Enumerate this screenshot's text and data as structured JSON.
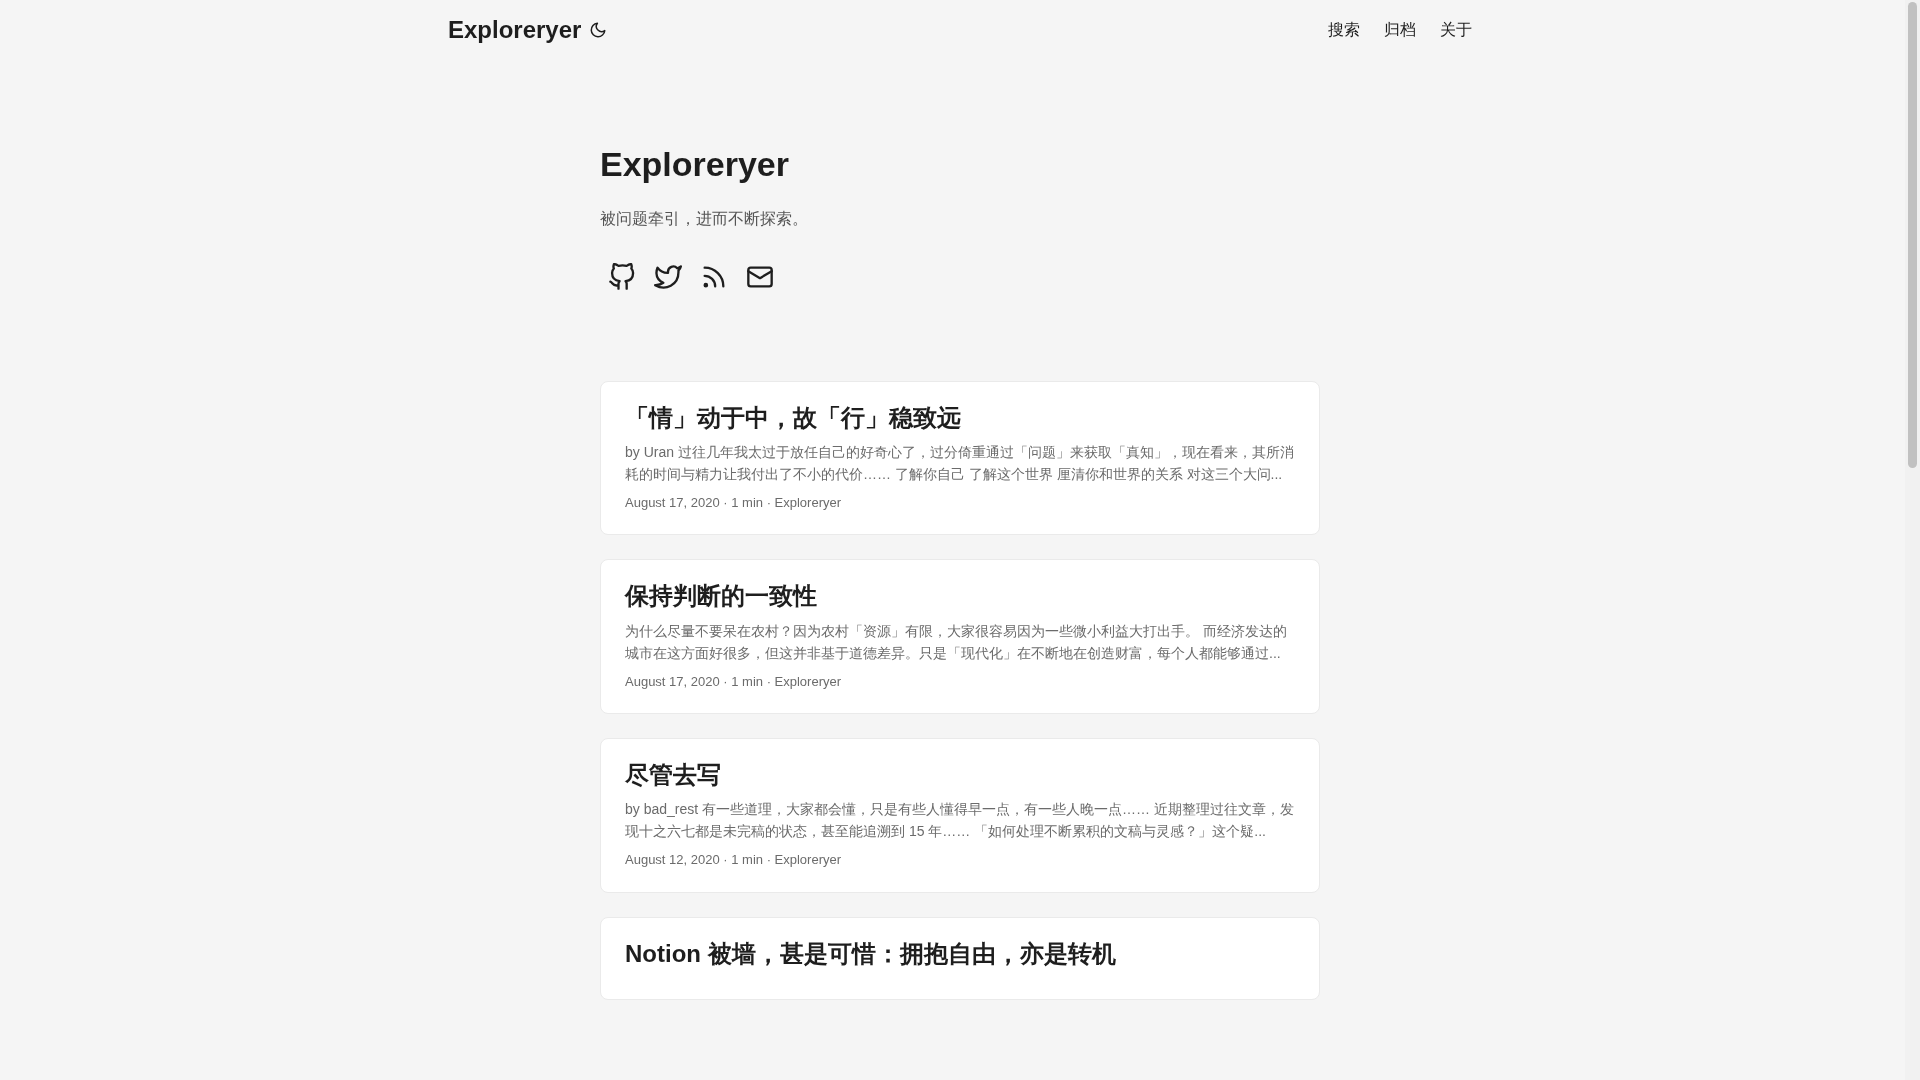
{
  "header": {
    "logo": "Exploreryer",
    "menu": [
      {
        "label": "搜索"
      },
      {
        "label": "归档"
      },
      {
        "label": "关于"
      }
    ]
  },
  "hero": {
    "title": "Exploreryer",
    "subtitle": "被问题牵引，进而不断探索。",
    "social": [
      {
        "kind": "github"
      },
      {
        "kind": "twitter"
      },
      {
        "kind": "rss"
      },
      {
        "kind": "email"
      }
    ]
  },
  "posts": [
    {
      "title": "「情」动于中，故「行」稳致远",
      "excerpt": "by Uran 过往几年我太过于放任自己的好奇心了，过分倚重通过「问题」来获取「真知」，现在看来，其所消耗的时间与精力让我付出了不小的代价…… 了解你自己 了解这个世界 厘清你和世界的关系 对这三个大问...",
      "meta": "August 17, 2020 · 1 min · Exploreryer"
    },
    {
      "title": "保持判断的一致性",
      "excerpt": "为什么尽量不要呆在农村？因为农村「资源」有限，大家很容易因为一些微小利益大打出手。 而经济发达的城市在这方面好很多，但这并非基于道德差异。只是「现代化」在不断地在创造财富，每个人都能够通过...",
      "meta": "August 17, 2020 · 1 min · Exploreryer"
    },
    {
      "title": "尽管去写",
      "excerpt": "by bad_rest 有一些道理，大家都会懂，只是有些人懂得早一点，有一些人晚一点…… 近期整理过往文章，发现十之六七都是未完稿的状态，甚至能追溯到 15 年…… 「如何处理不断累积的文稿与灵感？」这个疑...",
      "meta": "August 12, 2020 · 1 min · Exploreryer"
    },
    {
      "title": "Notion 被墙，甚是可惜：拥抱自由，亦是转机"
    }
  ]
}
